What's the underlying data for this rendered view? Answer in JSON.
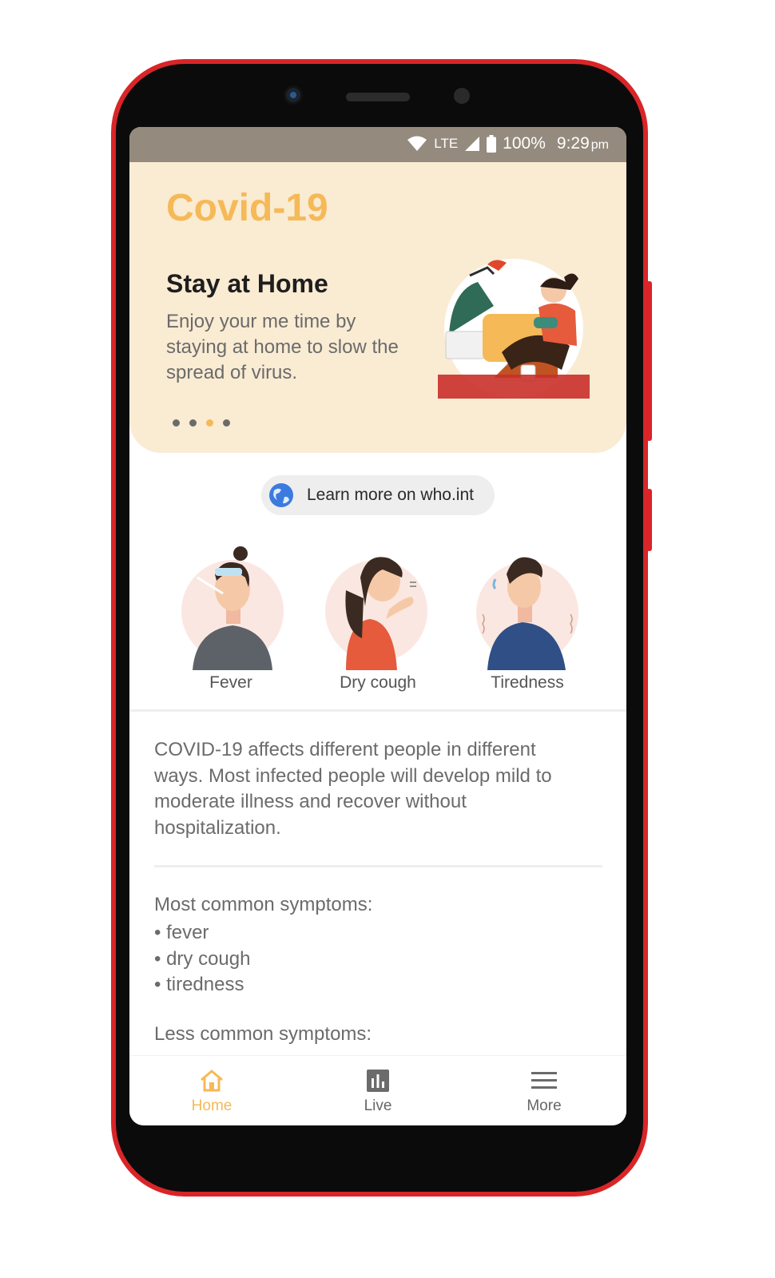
{
  "status_bar": {
    "network": "LTE",
    "battery": "100%",
    "time": "9:29",
    "time_suffix": "pm"
  },
  "hero": {
    "app_title": "Covid-19",
    "title": "Stay at Home",
    "description": "Enjoy your me time by staying at home to slow the spread of virus.",
    "carousel": {
      "total": 4,
      "active_index": 2
    }
  },
  "learn_more": {
    "label": "Learn more on who.int",
    "icon": "globe-icon"
  },
  "symptoms": [
    {
      "label": "Fever"
    },
    {
      "label": "Dry cough"
    },
    {
      "label": "Tiredness"
    }
  ],
  "info_text": "COVID-19 affects different people in different ways. Most infected people will develop mild to moderate illness and recover without hospitalization.",
  "common_symptoms": {
    "heading": "Most common symptoms:",
    "items": [
      "• fever",
      "• dry cough",
      "• tiredness"
    ]
  },
  "less_common_heading": "Less common symptoms:",
  "bottom_nav": {
    "items": [
      {
        "label": "Home",
        "icon": "home-icon",
        "active": true
      },
      {
        "label": "Live",
        "icon": "chart-icon",
        "active": false
      },
      {
        "label": "More",
        "icon": "menu-icon",
        "active": false
      }
    ]
  },
  "colors": {
    "accent": "#f6b957",
    "hero_bg": "#faebd3",
    "status_bar": "#948a7d",
    "phone_frame": "#d92528"
  }
}
